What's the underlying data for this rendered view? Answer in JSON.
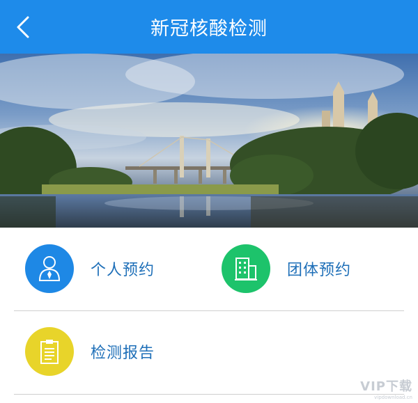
{
  "header": {
    "title": "新冠核酸检测",
    "back_icon": "chevron-left-icon",
    "background": "#1E8BEA"
  },
  "banner": {
    "description_icon": "bridge-landscape-photo"
  },
  "menu": {
    "personal": {
      "label": "个人预约",
      "icon": "person-icon",
      "color": "#1E88E5"
    },
    "group": {
      "label": "团体预约",
      "icon": "building-icon",
      "color": "#1DC36B"
    },
    "report": {
      "label": "检测报告",
      "icon": "clipboard-icon",
      "color": "#E8D42A"
    }
  },
  "watermark": {
    "main": "VIP下载",
    "sub": "vipdownload.cn"
  }
}
